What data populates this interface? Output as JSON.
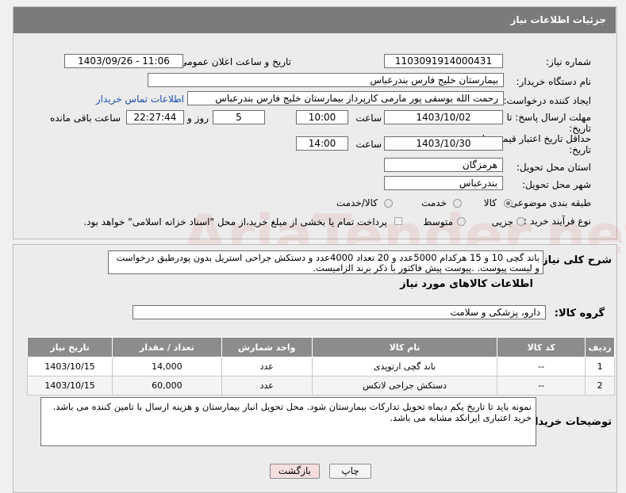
{
  "panel_title": "جزئیات اطلاعات نیاز",
  "fields": {
    "need_number_label": "شماره نیاز:",
    "need_number": "1103091914000431",
    "announce_label": "تاریخ و ساعت اعلان عمومی:",
    "announce_value": "1403/09/26 - 11:06",
    "buyer_org_label": "نام دستگاه خریدار:",
    "buyer_org": "بیمارستان خلیج فارس بندرعباس",
    "creator_label": "ایجاد کننده درخواست:",
    "creator": "رحمت الله یوسفی پور مارمی کارپرداز بیمارستان خلیج فارس بندرعباس",
    "contact_link": "اطلاعات تماس خریدار",
    "send_deadline_label_1": "مهلت ارسال پاسخ: تا",
    "send_deadline_label_2": "تاریخ:",
    "send_date": "1403/10/02",
    "time_label": "ساعت",
    "send_time": "10:00",
    "days": "5",
    "days_label": "روز و",
    "remaining": "22:27:44",
    "remaining_label": "ساعت باقی مانده",
    "validity_label_1": "حداقل تاریخ اعتبار قیمت: تا",
    "validity_label_2": "تاریخ:",
    "validity_date": "1403/10/30",
    "validity_time": "14:00",
    "province_label": "استان محل تحویل:",
    "province": "هرمزگان",
    "city_label": "شهر محل تحویل:",
    "city": "بندرعباس",
    "category_label": "طبقه بندی موضوعی:",
    "category_options": [
      "کالا",
      "خدمت",
      "کالا/خدمت"
    ],
    "process_label": "نوع فرآیند خرید :",
    "process_options": [
      "جزیی",
      "متوسط"
    ],
    "process_note": "پرداخت تمام یا بخشی از مبلغ خرید،از محل \"اسناد خزانه اسلامی\" خواهد بود."
  },
  "description": {
    "label": "شرح کلی نیاز:",
    "text": "باند گچی 10 و 15 هرکدام 5000عدد و 20 تعداد 4000عدد  و دستکش جراحی  استریل بدون پودرطبق درخواست و لیست پیوست. .پیوست پیش فاکتور با ذکر برند الزامیست."
  },
  "goods_section": {
    "title": "اطلاعات کالاهای مورد نیاز",
    "group_label": "گروه کالا:",
    "group_value": "دارو، پزشکی و سلامت"
  },
  "table": {
    "headers": [
      "ردیف",
      "کد کالا",
      "نام کالا",
      "واحد شمارش",
      "تعداد / مقدار",
      "تاریخ نیاز"
    ],
    "rows": [
      [
        "1",
        "--",
        "باند گچی ارتوپدی",
        "عدد",
        "14,000",
        "1403/10/15"
      ],
      [
        "2",
        "--",
        "دستکش جراحی لاتکس",
        "عدد",
        "60,000",
        "1403/10/15"
      ]
    ]
  },
  "buyer_notes": {
    "label": "توضیحات خریدار:",
    "text": "نمونه باید تا تاریخ یکم دیماه تحویل تدارکات بیمارستان شود. محل تحویل انبار بیمارستان و هزینه ارسال با تامین کننده می باشد.  خرید اعتباری    ایرانکد مشابه می باشد."
  },
  "buttons": {
    "print": "چاپ",
    "back": "بازگشت"
  },
  "watermark": "AriaTender.net",
  "colors": {
    "header": "#7b7b7b",
    "table_header": "#8c8c8c",
    "link": "#1f4fb3",
    "back_button": "#f6dede"
  }
}
